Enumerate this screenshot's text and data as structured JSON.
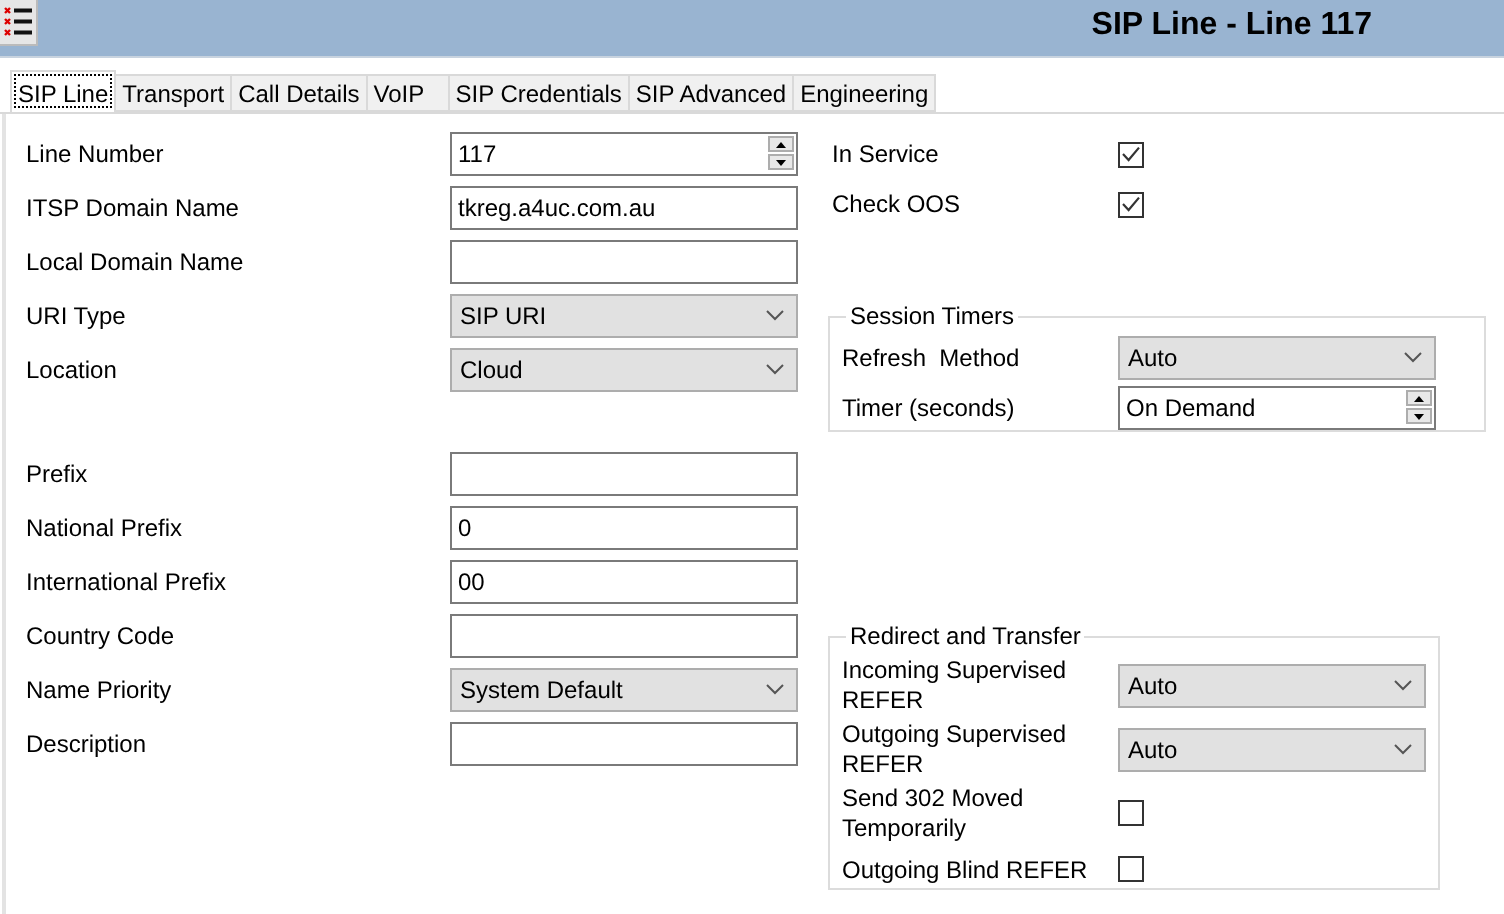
{
  "window": {
    "title": "SIP Line - Line 117"
  },
  "tabs": [
    {
      "label": "SIP Line",
      "selected": true
    },
    {
      "label": "Transport",
      "selected": false
    },
    {
      "label": "Call Details",
      "selected": false
    },
    {
      "label": "VoIP",
      "selected": false
    },
    {
      "label": "SIP Credentials",
      "selected": false
    },
    {
      "label": "SIP Advanced",
      "selected": false
    },
    {
      "label": "Engineering",
      "selected": false
    }
  ],
  "fields_top": [
    {
      "label": "Line Number",
      "kind": "spin",
      "value": "117"
    },
    {
      "label": "ITSP Domain Name",
      "kind": "text",
      "value": "tkreg.a4uc.com.au"
    },
    {
      "label": "Local Domain Name",
      "kind": "text"
    },
    {
      "label": "URI Type",
      "kind": "select",
      "value": "SIP URI"
    },
    {
      "label": "Location",
      "kind": "select",
      "value": "Cloud"
    }
  ],
  "fields_bottom": [
    {
      "label": "Prefix",
      "kind": "text"
    },
    {
      "label": "National Prefix",
      "kind": "text",
      "value": "0"
    },
    {
      "label": "International Prefix",
      "kind": "text",
      "value": "00"
    },
    {
      "label": "Country Code",
      "kind": "text"
    },
    {
      "label": "Name Priority",
      "kind": "select",
      "value": "System Default"
    },
    {
      "label": "Description",
      "kind": "text"
    }
  ],
  "status": [
    {
      "label": "In Service",
      "kind": "checkbox",
      "checked": true
    },
    {
      "label": "Check OOS",
      "kind": "checkbox",
      "checked": true
    }
  ],
  "session_timers": {
    "title": "Session Timers",
    "fields": [
      {
        "label": "Refresh  Method",
        "kind": "select",
        "value": "Auto"
      },
      {
        "label": "Timer (seconds)",
        "kind": "spin",
        "value": "On Demand"
      }
    ]
  },
  "redirect_and_transfer": {
    "title": "Redirect and Transfer",
    "fields": [
      {
        "label": "Incoming Supervised REFER",
        "kind": "select",
        "value": "Auto"
      },
      {
        "label": "Outgoing Supervised REFER",
        "kind": "select",
        "value": "Auto"
      },
      {
        "label": "Send 302 Moved Temporarily",
        "kind": "checkbox",
        "checked": false
      },
      {
        "label": "Outgoing Blind REFER",
        "kind": "checkbox",
        "checked": false
      }
    ]
  }
}
